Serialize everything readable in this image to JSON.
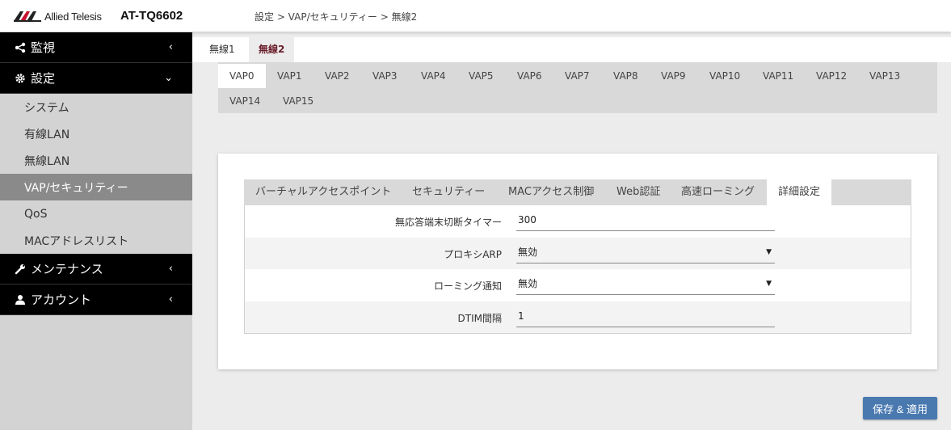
{
  "header": {
    "logo_text": "Allied Telesis",
    "product": "AT-TQ6602",
    "breadcrumb": "設定 > VAP/セキュリティー > 無線2"
  },
  "sidebar": {
    "groups": [
      {
        "label": "監視",
        "icon": "share-icon",
        "chevron": "‹"
      },
      {
        "label": "設定",
        "icon": "gear-icon",
        "chevron": "⌄"
      },
      {
        "label": "メンテナンス",
        "icon": "wrench-icon",
        "chevron": "‹"
      },
      {
        "label": "アカウント",
        "icon": "user-icon",
        "chevron": "‹"
      }
    ],
    "items": [
      {
        "label": "システム"
      },
      {
        "label": "有線LAN"
      },
      {
        "label": "無線LAN"
      },
      {
        "label": "VAP/セキュリティー"
      },
      {
        "label": "QoS"
      },
      {
        "label": "MACアドレスリスト"
      }
    ]
  },
  "radio_tabs": [
    "無線1",
    "無線2"
  ],
  "vap_tabs": [
    "VAP0",
    "VAP1",
    "VAP2",
    "VAP3",
    "VAP4",
    "VAP5",
    "VAP6",
    "VAP7",
    "VAP8",
    "VAP9",
    "VAP10",
    "VAP11",
    "VAP12",
    "VAP13",
    "VAP14",
    "VAP15"
  ],
  "sub_tabs": [
    "バーチャルアクセスポイント",
    "セキュリティー",
    "MACアクセス制御",
    "Web認証",
    "高速ローミング",
    "詳細設定"
  ],
  "form": {
    "rows": [
      {
        "label": "無応答端末切断タイマー",
        "value": "300"
      },
      {
        "label": "プロキシARP",
        "value": "無効"
      },
      {
        "label": "ローミング通知",
        "value": "無効"
      },
      {
        "label": "DTIM間隔",
        "value": "1"
      }
    ],
    "dropdown_arrow": "▼"
  },
  "save_label": "保存 & 適用",
  "colors": {
    "active_radio_tab": "#6b1e2b",
    "save_button": "#4a79b0",
    "sidebar_active": "#8a8a8a"
  }
}
